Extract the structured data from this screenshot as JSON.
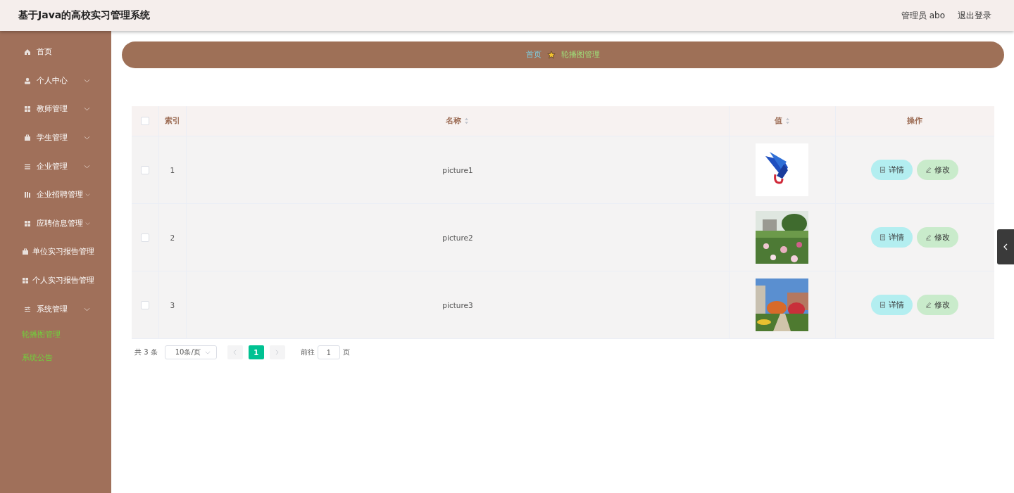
{
  "header": {
    "title": "基于Java的高校实习管理系统",
    "user": "管理员 abo",
    "logout": "退出登录"
  },
  "sidebar": {
    "items": [
      {
        "label": "首页",
        "collapsible": false
      },
      {
        "label": "个人中心",
        "collapsible": true
      },
      {
        "label": "教师管理",
        "collapsible": true
      },
      {
        "label": "学生管理",
        "collapsible": true
      },
      {
        "label": "企业管理",
        "collapsible": true
      },
      {
        "label": "企业招聘管理",
        "collapsible": true
      },
      {
        "label": "应聘信息管理",
        "collapsible": true
      },
      {
        "label": "单位实习报告管理",
        "collapsible": false
      },
      {
        "label": "个人实习报告管理",
        "collapsible": false
      },
      {
        "label": "系统管理",
        "collapsible": true,
        "children": [
          {
            "label": "轮播图管理"
          },
          {
            "label": "系统公告"
          }
        ]
      }
    ]
  },
  "breadcrumb": {
    "home": "首页",
    "current": "轮播图管理"
  },
  "table": {
    "select_all_checked": false,
    "columns": [
      {
        "label": "索引",
        "sortable": false
      },
      {
        "label": "名称",
        "sortable": true
      },
      {
        "label": "值",
        "sortable": true
      },
      {
        "label": "操作",
        "sortable": false
      }
    ],
    "rows": [
      {
        "checked": false,
        "index": "1",
        "name": "picture1",
        "value": {
          "kind": "picture"
        },
        "actions": [
          "详情",
          "修改"
        ]
      },
      {
        "checked": false,
        "index": "2",
        "name": "picture2",
        "value": {
          "kind": "picture"
        },
        "actions": [
          "详情",
          "修改"
        ]
      },
      {
        "checked": false,
        "index": "3",
        "name": "picture3",
        "value": {
          "kind": "picture"
        },
        "actions": [
          "详情",
          "修改"
        ]
      }
    ]
  },
  "pagination": {
    "total": "共 3 条",
    "page_size": "10条/页",
    "pages": [
      {
        "label": "1",
        "selected": true
      }
    ],
    "goto_label": "前往",
    "goto_value": "1",
    "goto_suffix": "页"
  }
}
